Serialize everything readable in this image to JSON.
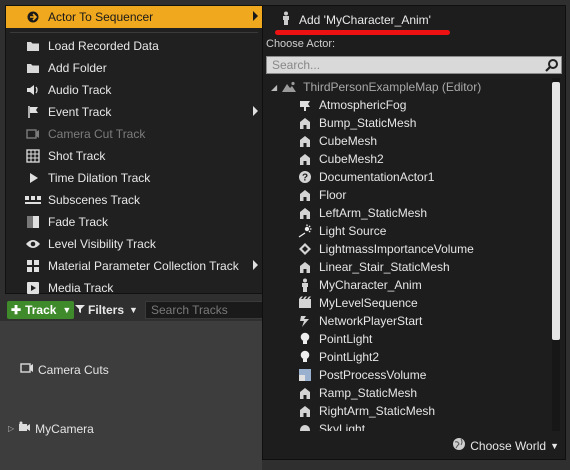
{
  "left_menu": {
    "items": [
      {
        "label": "Actor To Sequencer",
        "icon": "actor-icon",
        "highlight": true,
        "submenu": true
      },
      {
        "label": "Load Recorded Data",
        "icon": "folder-icon"
      },
      {
        "label": "Add Folder",
        "icon": "folder-icon"
      },
      {
        "label": "Audio Track",
        "icon": "speaker-icon"
      },
      {
        "label": "Event Track",
        "icon": "flag-icon",
        "submenu": true
      },
      {
        "label": "Camera Cut Track",
        "icon": "camera-cut-icon",
        "disabled": true
      },
      {
        "label": "Shot Track",
        "icon": "film-grid-icon"
      },
      {
        "label": "Time Dilation Track",
        "icon": "play-icon"
      },
      {
        "label": "Subscenes Track",
        "icon": "subscenes-icon"
      },
      {
        "label": "Fade Track",
        "icon": "fade-icon"
      },
      {
        "label": "Level Visibility Track",
        "icon": "eye-icon"
      },
      {
        "label": "Material Parameter Collection Track",
        "icon": "grid-icon",
        "submenu": true
      },
      {
        "label": "Media Track",
        "icon": "media-icon"
      }
    ]
  },
  "toolbar": {
    "track_label": "Track",
    "filters_label": "Filters",
    "search_placeholder": "Search Tracks"
  },
  "tracks": {
    "camera_cuts": "Camera Cuts",
    "my_camera": "MyCamera"
  },
  "actor_panel": {
    "add_label": "Add 'MyCharacter_Anim'",
    "choose_actor_label": "Choose Actor:",
    "search_placeholder": "Search...",
    "root_label": "ThirdPersonExampleMap (Editor)",
    "actors": [
      {
        "name": "AtmosphericFog",
        "icon": "fog-icon"
      },
      {
        "name": "Bump_StaticMesh",
        "icon": "static-mesh-icon"
      },
      {
        "name": "CubeMesh",
        "icon": "static-mesh-icon"
      },
      {
        "name": "CubeMesh2",
        "icon": "static-mesh-icon"
      },
      {
        "name": "DocumentationActor1",
        "icon": "help-icon"
      },
      {
        "name": "Floor",
        "icon": "static-mesh-icon"
      },
      {
        "name": "LeftArm_StaticMesh",
        "icon": "static-mesh-icon"
      },
      {
        "name": "Light Source",
        "icon": "light-source-icon"
      },
      {
        "name": "LightmassImportanceVolume",
        "icon": "volume-icon"
      },
      {
        "name": "Linear_Stair_StaticMesh",
        "icon": "static-mesh-icon"
      },
      {
        "name": "MyCharacter_Anim",
        "icon": "character-icon"
      },
      {
        "name": "MyLevelSequence",
        "icon": "sequence-icon"
      },
      {
        "name": "NetworkPlayerStart",
        "icon": "player-start-icon"
      },
      {
        "name": "PointLight",
        "icon": "point-light-icon"
      },
      {
        "name": "PointLight2",
        "icon": "point-light-icon"
      },
      {
        "name": "PostProcessVolume",
        "icon": "post-process-icon"
      },
      {
        "name": "Ramp_StaticMesh",
        "icon": "static-mesh-icon"
      },
      {
        "name": "RightArm_StaticMesh",
        "icon": "static-mesh-icon"
      },
      {
        "name": "SkyLight",
        "icon": "sky-light-icon"
      }
    ],
    "choose_world_label": "Choose World"
  },
  "colors": {
    "highlight": "#f0a81e",
    "track_button": "#3f8b2b",
    "annotation_underline": "#e11111"
  }
}
